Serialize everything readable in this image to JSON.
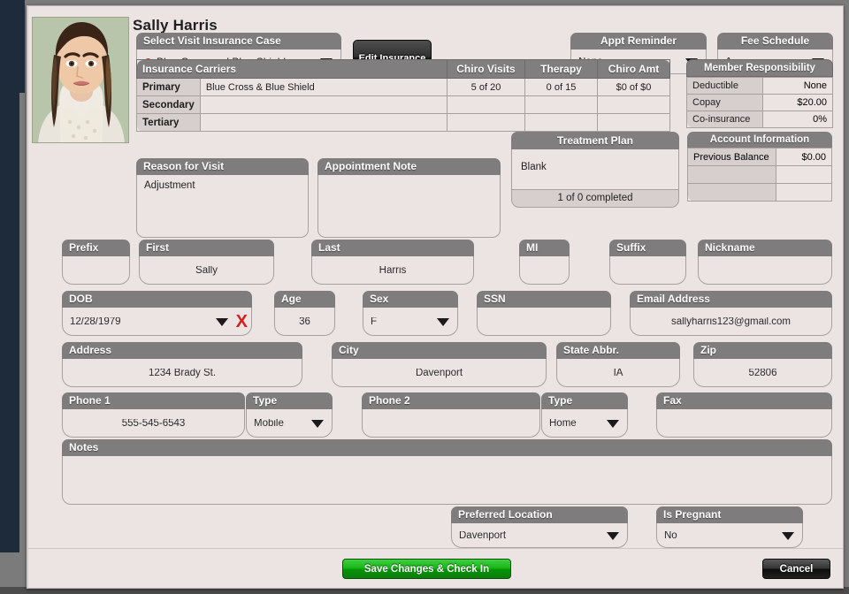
{
  "patient": {
    "name": "Sally Harris",
    "photo_alt": "patient-photo"
  },
  "insurance_case": {
    "label": "Select Visit Insurance Case",
    "value": "Blue Cross and Blue Shield",
    "status_color": "#e41d1d",
    "edit_button": "Edit Insurance"
  },
  "appt_reminder": {
    "label": "Appt Reminder",
    "value": "None"
  },
  "fee_schedule": {
    "label": "Fee Schedule",
    "value": "A"
  },
  "carriers": {
    "title": "Insurance Carriers",
    "columns": [
      "Chiro Visits",
      "Therapy",
      "Chiro Amt"
    ],
    "rows": [
      {
        "tier": "Primary",
        "carrier": "Blue Cross & Blue Shield",
        "chiro_visits": "5 of 20",
        "therapy": "0 of 15",
        "chiro_amt": "$0 of $0"
      },
      {
        "tier": "Secondary",
        "carrier": "",
        "chiro_visits": "",
        "therapy": "",
        "chiro_amt": ""
      },
      {
        "tier": "Tertiary",
        "carrier": "",
        "chiro_visits": "",
        "therapy": "",
        "chiro_amt": ""
      }
    ]
  },
  "member_responsibility": {
    "title": "Member Responsibility",
    "rows": [
      {
        "key": "Deductible",
        "value": "None"
      },
      {
        "key": "Copay",
        "value": "$20.00"
      },
      {
        "key": "Co-insurance",
        "value": "0%"
      }
    ]
  },
  "reason_for_visit": {
    "label": "Reason for Visit",
    "value": "Adjustment"
  },
  "appointment_note": {
    "label": "Appointment Note",
    "value": ""
  },
  "treatment_plan": {
    "label": "Treatment Plan",
    "value": "Blank",
    "progress": "1 of 0 completed"
  },
  "account_information": {
    "title": "Account Information",
    "rows": [
      {
        "key": "Previous Balance",
        "value": "$0.00"
      },
      {
        "key": "",
        "value": ""
      },
      {
        "key": "",
        "value": ""
      }
    ]
  },
  "fields": {
    "prefix": {
      "label": "Prefix",
      "value": ""
    },
    "first": {
      "label": "First",
      "value": "Sally"
    },
    "last": {
      "label": "Last",
      "value": "Harris"
    },
    "mi": {
      "label": "MI",
      "value": ""
    },
    "suffix": {
      "label": "Suffix",
      "value": ""
    },
    "nickname": {
      "label": "Nickname",
      "value": ""
    },
    "dob": {
      "label": "DOB",
      "value": "12/28/1979",
      "clear_glyph": "X"
    },
    "age": {
      "label": "Age",
      "value": "36"
    },
    "sex": {
      "label": "Sex",
      "value": "F"
    },
    "ssn": {
      "label": "SSN",
      "value": ""
    },
    "email": {
      "label": "Email Address",
      "value": "sallyharris123@gmail.com"
    },
    "address": {
      "label": "Address",
      "value": "1234 Brady St."
    },
    "city": {
      "label": "City",
      "value": "Davenport"
    },
    "state": {
      "label": "State Abbr.",
      "value": "IA"
    },
    "zip": {
      "label": "Zip",
      "value": "52806"
    },
    "phone1": {
      "label": "Phone 1",
      "value": "555-545-6543"
    },
    "phone1_type": {
      "label": "Type",
      "value": "Mobile"
    },
    "phone2": {
      "label": "Phone 2",
      "value": ""
    },
    "phone2_type": {
      "label": "Type",
      "value": "Home"
    },
    "fax": {
      "label": "Fax",
      "value": ""
    },
    "notes": {
      "label": "Notes",
      "value": ""
    },
    "preferred_location": {
      "label": "Preferred Location",
      "value": "Davenport"
    },
    "is_pregnant": {
      "label": "Is Pregnant",
      "value": "No"
    }
  },
  "footer": {
    "save": "Save Changes & Check In",
    "cancel": "Cancel"
  }
}
